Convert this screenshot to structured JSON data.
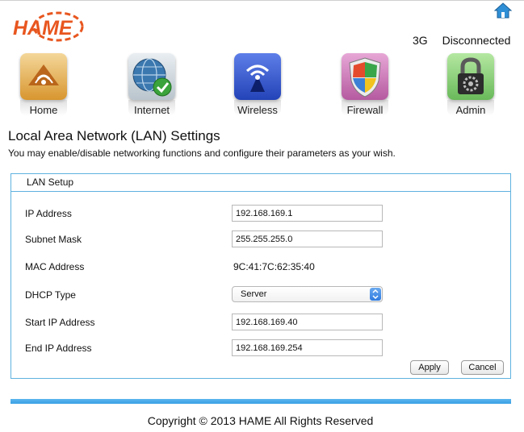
{
  "brand": {
    "logo_text": "HAME",
    "logo_color": "#e8561f"
  },
  "status": {
    "network": "3G",
    "connection": "Disconnected"
  },
  "nav": [
    {
      "label": "Home",
      "icon": "home-icon"
    },
    {
      "label": "Internet",
      "icon": "globe-check-icon"
    },
    {
      "label": "Wireless",
      "icon": "wireless-signal-icon"
    },
    {
      "label": "Firewall",
      "icon": "shield-icon"
    },
    {
      "label": "Admin",
      "icon": "padlock-gear-icon"
    }
  ],
  "page": {
    "title": "Local Area Network (LAN) Settings",
    "description": "You may enable/disable networking functions and configure their parameters as your wish."
  },
  "lan_setup": {
    "heading": "LAN Setup",
    "ip_address_label": "IP Address",
    "ip_address": "192.168.169.1",
    "subnet_mask_label": "Subnet Mask",
    "subnet_mask": "255.255.255.0",
    "mac_address_label": "MAC Address",
    "mac_address": "9C:41:7C:62:35:40",
    "dhcp_type_label": "DHCP Type",
    "dhcp_type": "Server",
    "start_ip_label": "Start IP Address",
    "start_ip": "192.168.169.40",
    "end_ip_label": "End IP Address",
    "end_ip": "192.168.169.254",
    "apply_label": "Apply",
    "cancel_label": "Cancel"
  },
  "footer": {
    "copyright": "Copyright © 2013 HAME All Rights Reserved"
  },
  "colors": {
    "accent_blue": "#4aa9e8",
    "panel_border": "#5fb2e0"
  }
}
